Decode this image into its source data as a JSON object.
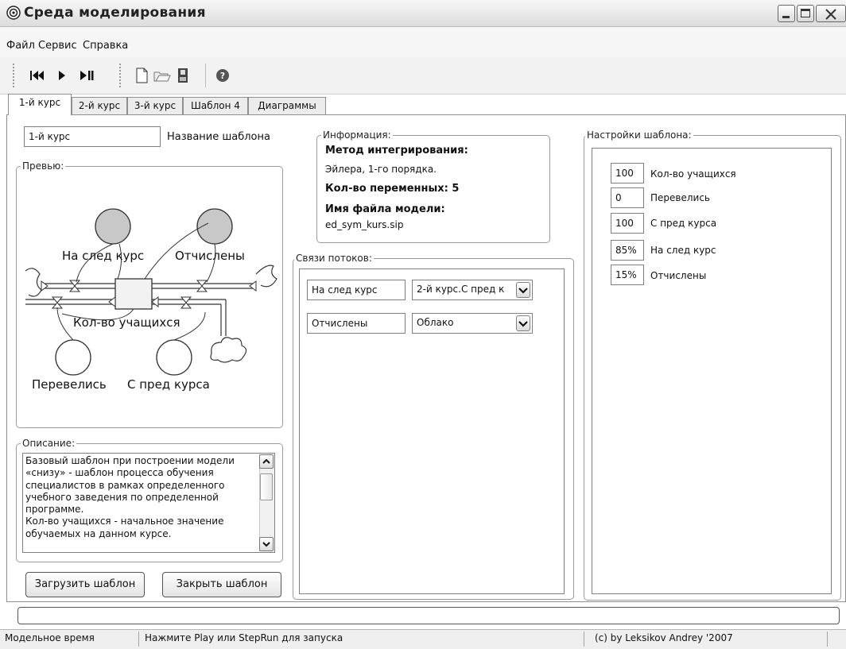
{
  "window": {
    "title": "Среда моделирования"
  },
  "menu": [
    {
      "label": "Файл"
    },
    {
      "label": "Сервис"
    },
    {
      "label": "Справка"
    }
  ],
  "tabs": [
    {
      "label": "1-й курс",
      "active": true
    },
    {
      "label": "2-й курс"
    },
    {
      "label": "3-й курс"
    },
    {
      "label": "Шаблон 4"
    },
    {
      "label": "Диаграммы"
    }
  ],
  "left": {
    "template_name_value": "1-й курс",
    "template_name_label": "Название шаблона",
    "preview_legend": "Превью:",
    "diagram": {
      "flow_upper_left": "На след курс",
      "flow_upper_right": "Отчислены",
      "stock_label": "Кол-во учащихся",
      "aux_lower_left": "Перевелись",
      "aux_lower_right": "С пред курса"
    },
    "description_legend": "Описание:",
    "description_lines": [
      "Базовый шаблон при построении модели",
      "«снизу»  - шаблон процесса обучения",
      "специалистов в рамках определенного",
      "учебного заведения по определенной",
      "программе.",
      "Кол-во учащихся - начальное значение",
      "обучаемых на данном курсе."
    ],
    "load_button": "Загрузить шаблон",
    "close_button": "Закрыть шаблон"
  },
  "info": {
    "legend": "Информация:",
    "method_heading": "Метод интегрирования:",
    "method_value": "Эйлера, 1-го порядка.",
    "vars_heading": "Кол-во переменных: 5",
    "file_heading": "Имя файла модели:",
    "file_value": "ed_sym_kurs.sip"
  },
  "flows": {
    "legend": "Связи потоков:",
    "rows": [
      {
        "name": "На след курс",
        "target": "2-й курс.С пред к"
      },
      {
        "name": "Отчислены",
        "target": "Облако"
      }
    ]
  },
  "settings": {
    "legend": "Настройки шаблона:",
    "rows": [
      {
        "value": "100",
        "label": "Кол-во учащихся"
      },
      {
        "value": "0",
        "label": "Перевелись"
      },
      {
        "value": "100",
        "label": "С пред курса"
      },
      {
        "value": "85%",
        "label": "На след курс"
      },
      {
        "value": "15%",
        "label": "Отчислены"
      }
    ]
  },
  "status": {
    "model_time": "Модельное время",
    "hint": "Нажмите Play или StepRun для запуска",
    "copyright": "(c) by Leksikov Andrey '2007"
  }
}
